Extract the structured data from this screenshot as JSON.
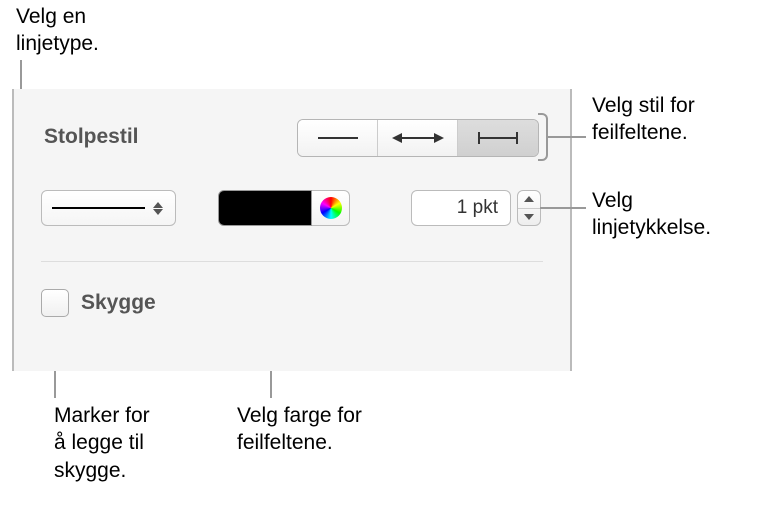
{
  "callouts": {
    "linetype": "Velg en\nlinjetype.",
    "errorbar_style": "Velg stil for\nfeilfeltene.",
    "thickness": "Velg\nlinjetykkelse.",
    "shadow": "Marker for\nå legge til\nskygge.",
    "color": "Velg farge for\nfeilfeltene."
  },
  "panel": {
    "section_title": "Stolpestil",
    "thickness_value": "1 pkt",
    "shadow_label": "Skygge"
  }
}
